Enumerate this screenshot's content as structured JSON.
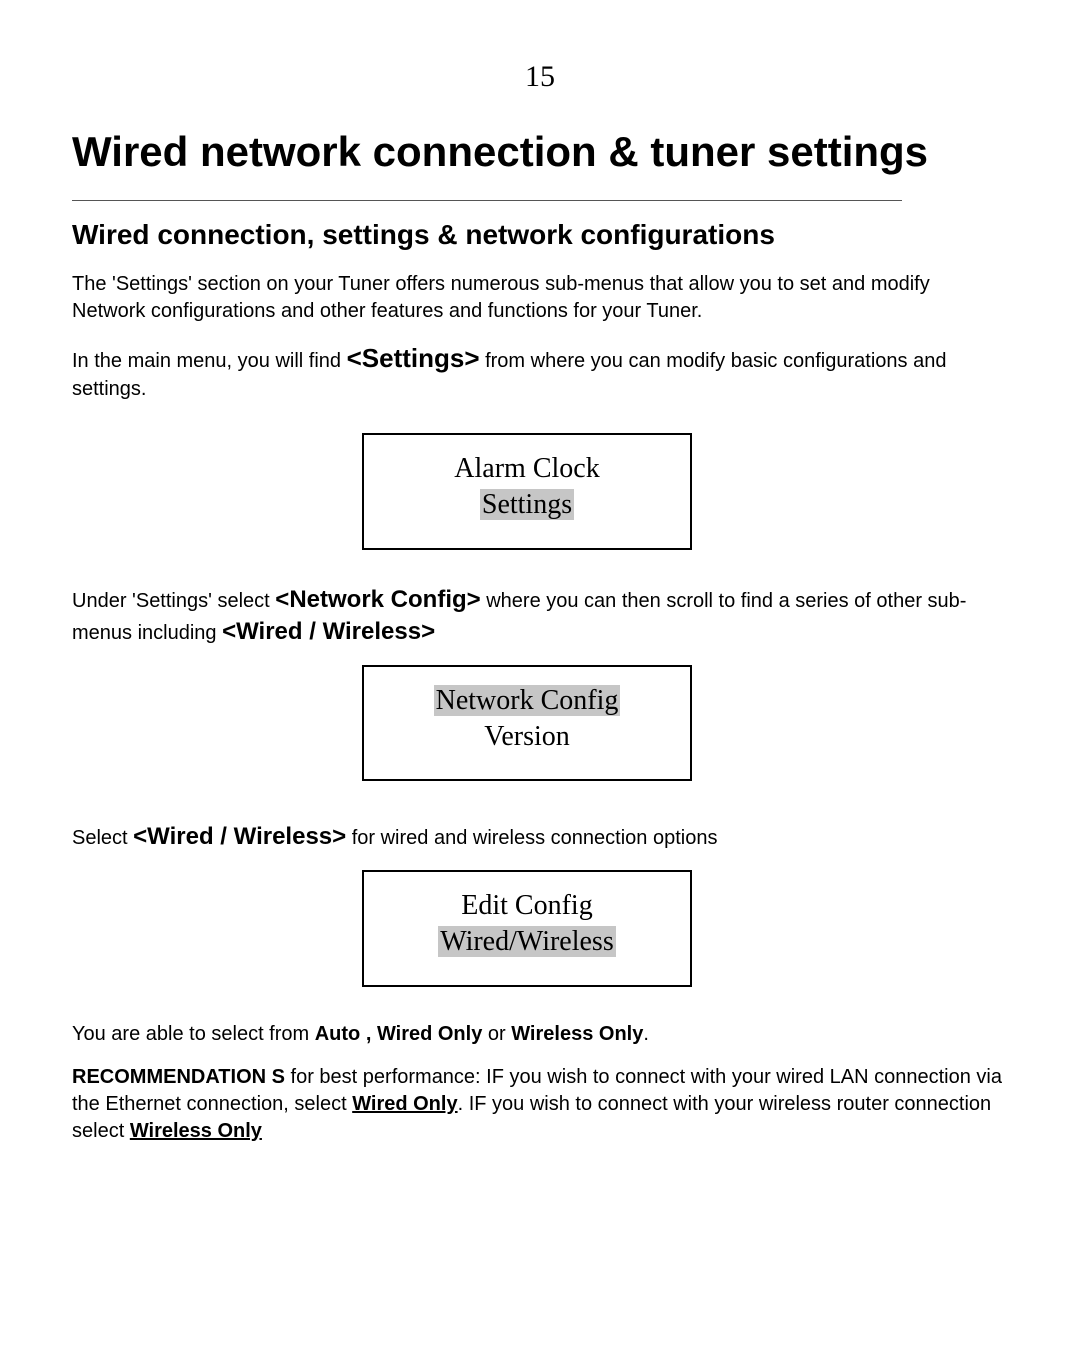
{
  "page_number": "15",
  "title": "Wired network connection & tuner settings",
  "subtitle": "Wired connection, settings & network configurations",
  "intro1": "The 'Settings' section on your Tuner offers numerous sub-menus that allow you to set and modify Network configurations and other features and functions for your Tuner.",
  "intro2a": "In the main menu, you will find ",
  "intro2b_ui": "<Settings>",
  "intro2c": "  from where you can modify basic configurations and settings.",
  "menu1": {
    "line1": "Alarm Clock",
    "line2_sel": "Settings"
  },
  "para2a": "Under 'Settings' select ",
  "para2b_ui": "<Network Config>",
  "para2c": "  where you can then scroll to find a series of other sub-menus including ",
  "para2d_ui": "<Wired / Wireless>",
  "menu2": {
    "line1_sel": "Network Config",
    "line2": "Version"
  },
  "para3a": "Select ",
  "para3b_ui": "<Wired / Wireless>",
  "para3c": "  for wired and wireless connection options",
  "menu3": {
    "line1": "Edit Config",
    "line2_sel": "Wired/Wireless"
  },
  "options_a": "You are able to select from ",
  "options_b": "Auto , Wired  Only ",
  "options_c": "or ",
  "options_d": "Wireless Only",
  "options_e": ".",
  "rec_label": "RECOMMENDATION S",
  "rec_a": "  for best performance:  IF you wish to connect with your wired LAN connection via the Ethernet connection, select ",
  "rec_wired": "Wired Only",
  "rec_b": ".  IF you wish to connect with your wireless router connection select ",
  "rec_wireless": "Wireless Only"
}
